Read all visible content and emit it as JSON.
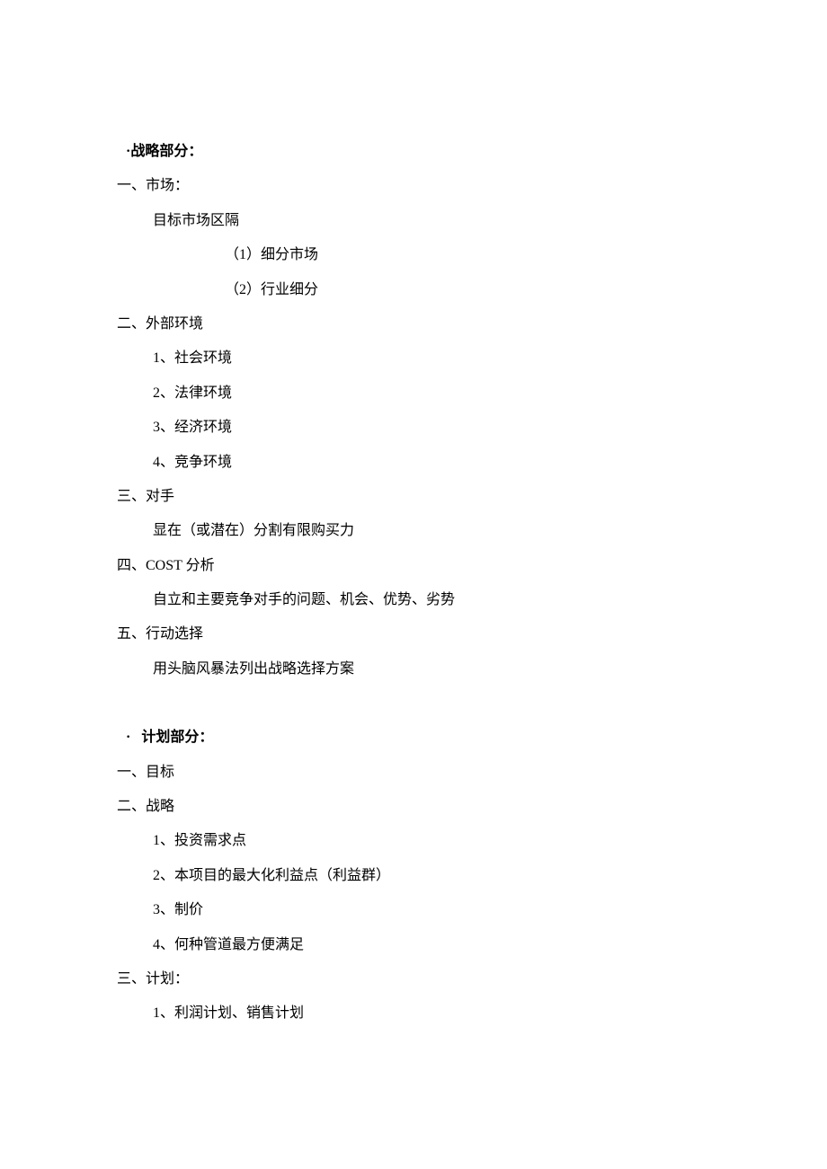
{
  "section1": {
    "header_bullet": "·",
    "header_text": "战略部分：",
    "items": [
      {
        "level": 1,
        "text": "一、市场："
      },
      {
        "level": 2,
        "text": "目标市场区隔"
      },
      {
        "level": 3,
        "text": "（1）细分市场"
      },
      {
        "level": 3,
        "text": "（2）行业细分"
      },
      {
        "level": 1,
        "text": "二、外部环境"
      },
      {
        "level": 2,
        "text": "1、社会环境"
      },
      {
        "level": 2,
        "text": "2、法律环境"
      },
      {
        "level": 2,
        "text": "3、经济环境"
      },
      {
        "level": 2,
        "text": "4、竞争环境"
      },
      {
        "level": 1,
        "text": "三、对手"
      },
      {
        "level": 2,
        "text": "显在（或潜在）分割有限购买力"
      },
      {
        "level": 1,
        "text": "四、COST 分析"
      },
      {
        "level": 2,
        "text": "自立和主要竞争对手的问题、机会、优势、劣势"
      },
      {
        "level": 1,
        "text": "五、行动选择"
      },
      {
        "level": 2,
        "text": "用头脑风暴法列出战略选择方案"
      }
    ]
  },
  "section2": {
    "header_bullet": "·",
    "header_text": "计划部分：",
    "items": [
      {
        "level": 1,
        "text": "一、目标"
      },
      {
        "level": 1,
        "text": "二、战略"
      },
      {
        "level": 2,
        "text": "1、投资需求点"
      },
      {
        "level": 2,
        "text": "2、本项目的最大化利益点（利益群）"
      },
      {
        "level": 2,
        "text": "3、制价"
      },
      {
        "level": 2,
        "text": "4、何种管道最方便满足"
      },
      {
        "level": 1,
        "text": "三、计划："
      },
      {
        "level": 2,
        "text": "1、利润计划、销售计划"
      }
    ]
  }
}
